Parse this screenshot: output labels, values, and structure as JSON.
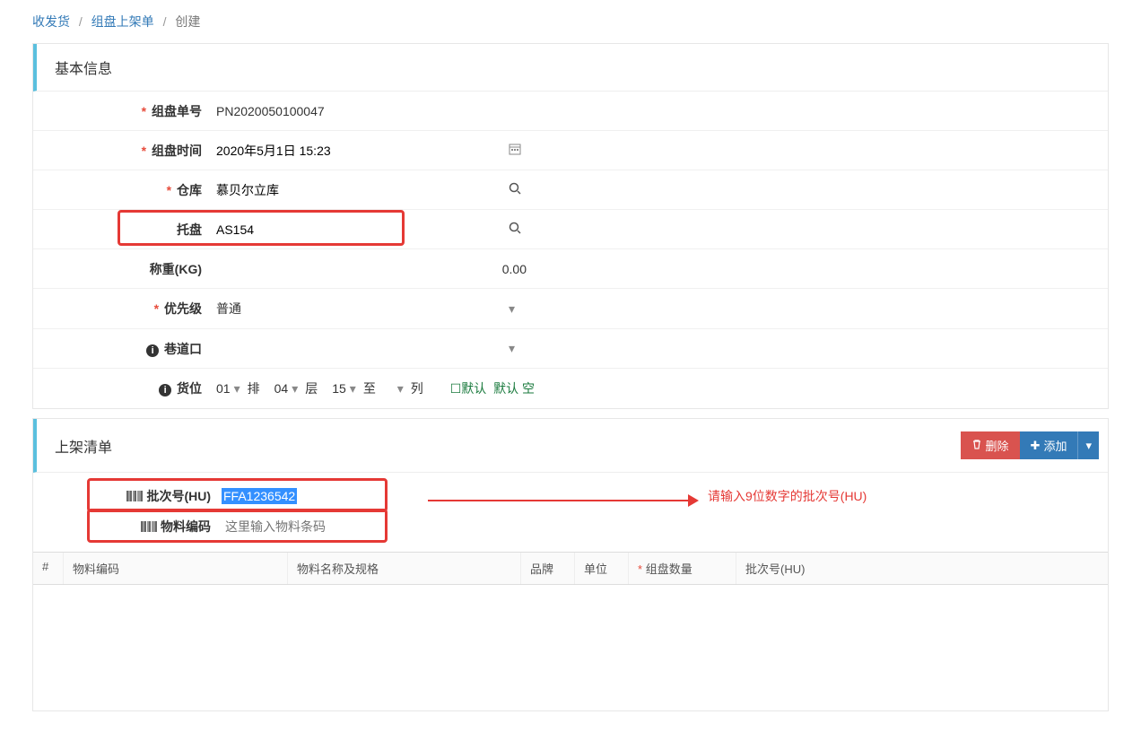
{
  "breadcrumb": {
    "l1": "收发货",
    "l2": "组盘上架单",
    "current": "创建"
  },
  "panel1": {
    "title": "基本信息",
    "fields": {
      "pallet_no_label": "组盘单号",
      "pallet_no_value": "PN2020050100047",
      "pallet_time_label": "组盘时间",
      "pallet_time_value": "2020年5月1日 15:23",
      "warehouse_label": "仓库",
      "warehouse_value": "慕贝尔立库",
      "tray_label": "托盘",
      "tray_value": "AS154",
      "weight_label": "称重(KG)",
      "weight_value": "0.00",
      "priority_label": "优先级",
      "priority_value": "普通",
      "lane_label": "巷道口",
      "lane_value": "",
      "slot_label": "货位",
      "slot_row": "01",
      "slot_row_lbl": "排",
      "slot_col": "04",
      "slot_col_lbl": "层",
      "slot_layer": "15",
      "slot_layer_lbl": "至",
      "slot_cell_lbl": "列",
      "slot_tag1": "☐默认",
      "slot_tag2": "默认 空"
    }
  },
  "panel2": {
    "title": "上架清单",
    "delete_btn": "删除",
    "add_btn": "添加",
    "batch_label": "批次号(HU)",
    "batch_value": "FFA1236542",
    "material_label": "物料编码",
    "material_placeholder": "这里输入物料条码",
    "annotation": "请输入9位数字的批次号(HU)",
    "grid": {
      "num": "#",
      "code": "物料编码",
      "name": "物料名称及规格",
      "brand": "品牌",
      "unit": "单位",
      "qty": "组盘数量",
      "batch": "批次号(HU)"
    }
  }
}
